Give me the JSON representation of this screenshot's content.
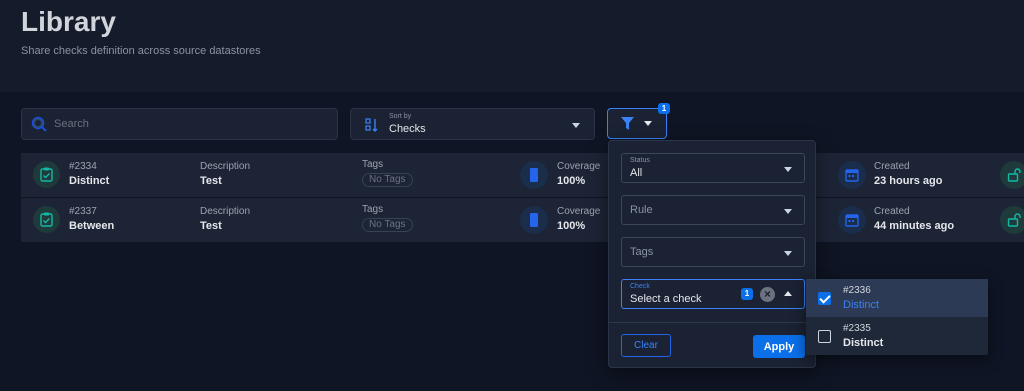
{
  "header": {
    "title": "Library",
    "subtitle": "Share checks definition across source datastores"
  },
  "toolbar": {
    "search": {
      "placeholder": "Search",
      "value": ""
    },
    "sort": {
      "label": "Sort by",
      "value": "Checks"
    },
    "filter": {
      "badge": "1"
    }
  },
  "columns": {
    "description": "Description",
    "tags": "Tags",
    "coverage": "Coverage",
    "created": "Created"
  },
  "rows": [
    {
      "id": "#2334",
      "name": "Distinct",
      "description": "Test",
      "tags": "No Tags",
      "coverage": "100%",
      "created": "23 hours ago"
    },
    {
      "id": "#2337",
      "name": "Between",
      "description": "Test",
      "tags": "No Tags",
      "coverage": "100%",
      "created": "44 minutes ago"
    }
  ],
  "filter_panel": {
    "status": {
      "label": "Status",
      "value": "All"
    },
    "rule": {
      "placeholder": "Rule"
    },
    "tags": {
      "placeholder": "Tags"
    },
    "check": {
      "label": "Check",
      "placeholder": "Select a check",
      "count": "1"
    },
    "clear_label": "Clear",
    "apply_label": "Apply"
  },
  "check_options": [
    {
      "id": "#2336",
      "name": "Distinct",
      "checked": true
    },
    {
      "id": "#2335",
      "name": "Distinct",
      "checked": false
    }
  ],
  "colors": {
    "accent": "#0a6fe8",
    "background": "#111827",
    "row": "#1c2436",
    "teal_icon": "#14b8a6"
  }
}
